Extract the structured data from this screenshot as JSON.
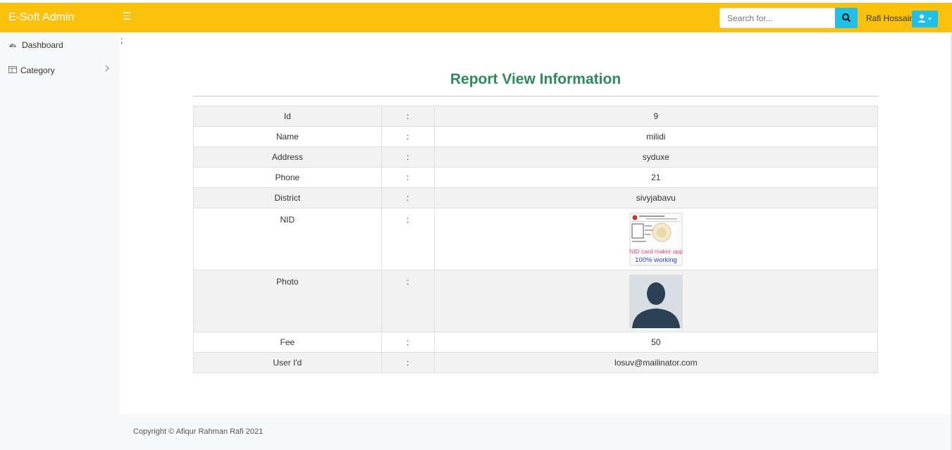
{
  "app": {
    "brand": "E-Soft Admin"
  },
  "search": {
    "placeholder": "Search for..."
  },
  "user": {
    "name": "Rafi Hossain"
  },
  "sidebar": {
    "items": [
      {
        "label": "Dashboard",
        "icon": "dashboard-icon"
      },
      {
        "label": "Category",
        "icon": "table-icon"
      }
    ]
  },
  "page": {
    "stray_text": ";",
    "title": "Report View Information"
  },
  "report": {
    "separator": ":",
    "rows": [
      {
        "label": "Id",
        "value": "9"
      },
      {
        "label": "Name",
        "value": "milidi"
      },
      {
        "label": "Address",
        "value": "syduxe"
      },
      {
        "label": "Phone",
        "value": "21"
      },
      {
        "label": "District",
        "value": "sivyjabavu"
      },
      {
        "label": "NID",
        "image_text_1": "NID card maker app",
        "image_text_2": "100% working"
      },
      {
        "label": "Photo"
      },
      {
        "label": "Fee",
        "value": "50"
      },
      {
        "label": "User I'd",
        "value": "losuv@mailinator.com"
      }
    ]
  },
  "footer": {
    "text": "Copyright © Afiqur Rahman Rafi 2021"
  },
  "colors": {
    "topbar": "#fcc10d",
    "accent": "#1ec0e9",
    "title": "#2e8a5d"
  }
}
